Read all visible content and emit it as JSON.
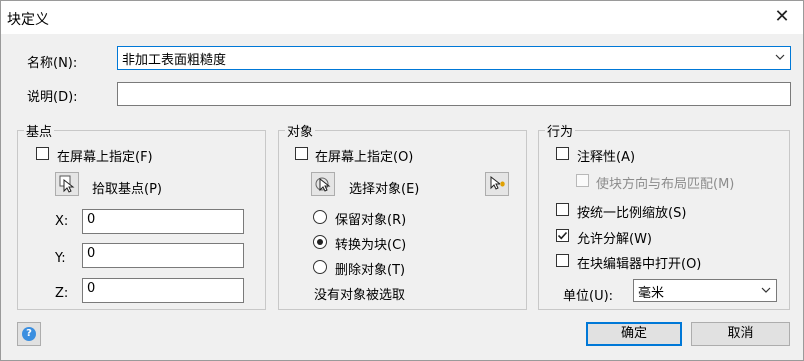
{
  "window": {
    "title": "块定义",
    "close_glyph": "✕"
  },
  "name_row": {
    "label": "名称(N):",
    "value": "非加工表面粗糙度"
  },
  "desc_row": {
    "label": "说明(D):",
    "value": ""
  },
  "base_point": {
    "title": "基点",
    "on_screen_label": "在屏幕上指定(F)",
    "on_screen_checked": false,
    "pick_label": "拾取基点(P)",
    "x_label": "X:",
    "x_value": "0",
    "y_label": "Y:",
    "y_value": "0",
    "z_label": "Z:",
    "z_value": "0"
  },
  "objects": {
    "title": "对象",
    "on_screen_label": "在屏幕上指定(O)",
    "on_screen_checked": false,
    "select_label": "选择对象(E)",
    "retain_label": "保留对象(R)",
    "convert_label": "转换为块(C)",
    "delete_label": "删除对象(T)",
    "selected_option": "convert",
    "status": "没有对象被选取"
  },
  "behavior": {
    "title": "行为",
    "annotative_label": "注释性(A)",
    "annotative_checked": false,
    "match_label": "使块方向与布局匹配(M)",
    "match_checked": false,
    "scale_uniform_label": "按统一比例缩放(S)",
    "scale_uniform_checked": false,
    "explode_label": "允许分解(W)",
    "explode_checked": true,
    "open_editor_label": "在块编辑器中打开(O)",
    "open_editor_checked": false,
    "unit_label": "单位(U):",
    "unit_value": "毫米"
  },
  "footer": {
    "ok_label": "确定",
    "cancel_label": "取消",
    "help_glyph": "?"
  }
}
